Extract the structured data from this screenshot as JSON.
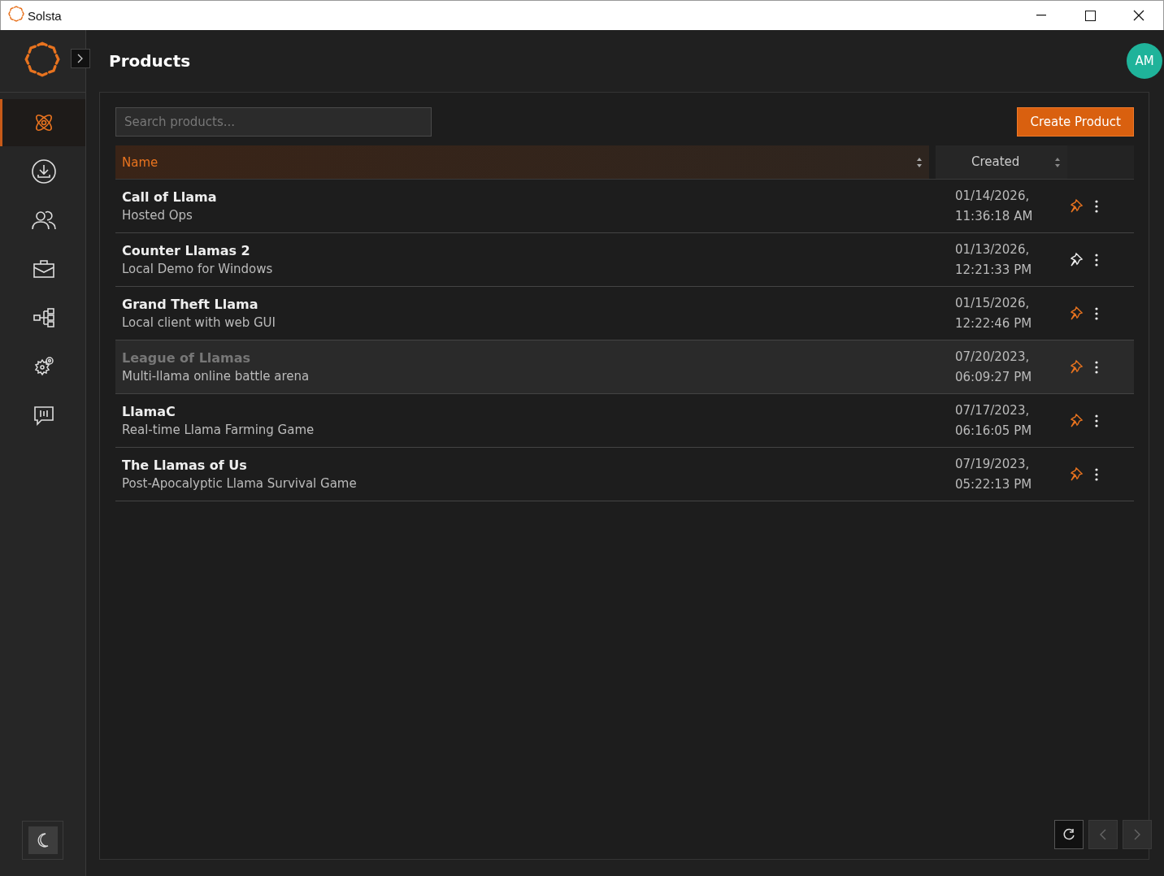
{
  "window": {
    "title": "Solsta"
  },
  "sidebar": {
    "items": [
      {
        "selected": true
      },
      {
        "selected": false
      },
      {
        "selected": false
      },
      {
        "selected": false
      },
      {
        "selected": false
      },
      {
        "selected": false
      },
      {
        "selected": false
      }
    ]
  },
  "header": {
    "title": "Products",
    "avatar": "AM"
  },
  "search": {
    "placeholder": "Search products..."
  },
  "create_button": "Create Product",
  "table": {
    "columns": [
      "Name",
      "Created"
    ],
    "rows": [
      {
        "name": "Call of Llama",
        "description": "Hosted Ops",
        "created": [
          "01/14/2026,",
          "11:36:18 AM"
        ],
        "pinned": true,
        "hovered": false
      },
      {
        "name": "Counter Llamas 2",
        "description": "Local Demo for Windows",
        "created": [
          "01/13/2026,",
          "12:21:33 PM"
        ],
        "pinned": false,
        "hovered": false
      },
      {
        "name": "Grand Theft Llama",
        "description": "Local client with web GUI",
        "created": [
          "01/15/2026,",
          "12:22:46 PM"
        ],
        "pinned": true,
        "hovered": false
      },
      {
        "name": "League of Llamas",
        "description": "Multi-llama online battle arena",
        "created": [
          "07/20/2023,",
          "06:09:27 PM"
        ],
        "pinned": true,
        "hovered": true
      },
      {
        "name": "LlamaC",
        "description": "Real-time Llama Farming Game",
        "created": [
          "07/17/2023,",
          "06:16:05 PM"
        ],
        "pinned": true,
        "hovered": false
      },
      {
        "name": "The Llamas of Us",
        "description": "Post-Apocalyptic Llama Survival Game",
        "created": [
          "07/19/2023,",
          "05:22:13 PM"
        ],
        "pinned": true,
        "hovered": false
      }
    ]
  },
  "pagination": {
    "previous_disabled": true,
    "next_disabled": true
  }
}
